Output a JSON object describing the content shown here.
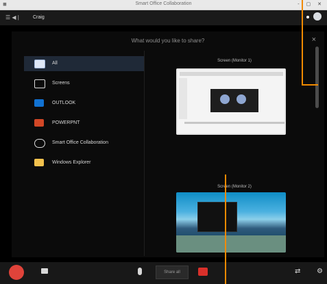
{
  "window": {
    "title": "Smart Office Collaboration",
    "controls": "- ▢ ✕"
  },
  "appbar": {
    "menu_icon": "menu-icon",
    "username": "Craig",
    "avatar": "avatar"
  },
  "dialog": {
    "title": "What would you like to share?",
    "close_label": "×",
    "sources": [
      {
        "label": "All",
        "icon": "monitor-icon",
        "selected": true
      },
      {
        "label": "Screens",
        "icon": "screen-icon",
        "selected": false
      },
      {
        "label": "OUTLOOK",
        "icon": "outlook-icon",
        "selected": false
      },
      {
        "label": "POWERPNT",
        "icon": "powerpoint-icon",
        "selected": false
      },
      {
        "label": "Smart Office Collaboration",
        "icon": "cloud-icon",
        "selected": false
      },
      {
        "label": "Windows Explorer",
        "icon": "folder-icon",
        "selected": false
      }
    ],
    "screens": [
      {
        "label": "Screen (Monitor 1)"
      },
      {
        "label": "Screen (Monitor 2)"
      }
    ]
  },
  "toolbar": {
    "share_label": "Share all"
  },
  "colors": {
    "accent_pointer": "#f18a00",
    "selected_bg": "#1f2937",
    "hangup": "#e0433a",
    "video_stop": "#d9302a"
  }
}
